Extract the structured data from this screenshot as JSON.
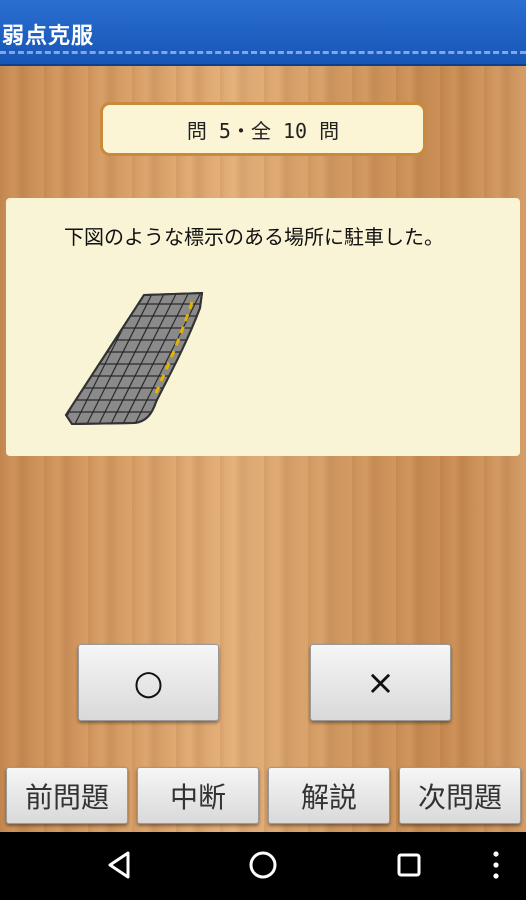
{
  "app": {
    "title": "弱点克服"
  },
  "counter": {
    "text": "問 5・全 10 問"
  },
  "question": {
    "text": "下図のような標示のある場所に駐車した。",
    "illustration_icon": "crosshatched-curb-marking"
  },
  "answers": {
    "true_label": "○",
    "false_label": "×"
  },
  "nav": {
    "prev_label": "前問題",
    "pause_label": "中断",
    "explain_label": "解説",
    "next_label": "次問題"
  },
  "system_nav": {
    "back_icon": "back-triangle-icon",
    "home_icon": "home-circle-icon",
    "recents_icon": "recents-square-icon",
    "menu_icon": "overflow-menu-icon"
  },
  "colors": {
    "titlebar": "#1e62c4",
    "panel": "#faf4d6",
    "counter_border": "#c98a3a",
    "stripe": "#e3b300"
  }
}
